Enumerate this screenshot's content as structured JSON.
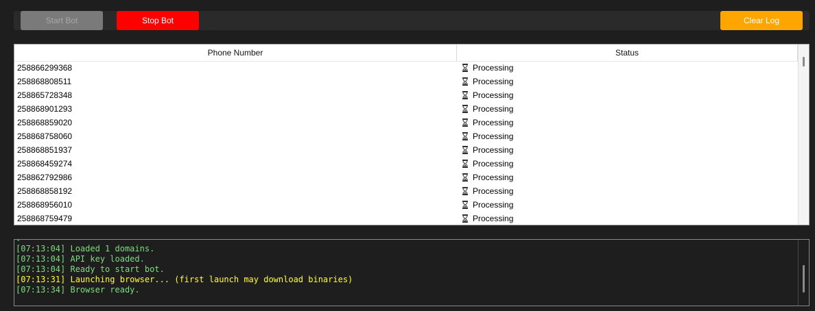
{
  "toolbar": {
    "start_label": "Start Bot",
    "stop_label": "Stop Bot",
    "clear_label": "Clear Log"
  },
  "table": {
    "columns": [
      "Phone Number",
      "Status"
    ],
    "rows": [
      {
        "phone": "258866299368",
        "status": "Processing",
        "status_icon": "hourglass-icon"
      },
      {
        "phone": "258868808511",
        "status": "Processing",
        "status_icon": "hourglass-icon"
      },
      {
        "phone": "258865728348",
        "status": "Processing",
        "status_icon": "hourglass-icon"
      },
      {
        "phone": "258868901293",
        "status": "Processing",
        "status_icon": "hourglass-icon"
      },
      {
        "phone": "258868859020",
        "status": "Processing",
        "status_icon": "hourglass-icon"
      },
      {
        "phone": "258868758060",
        "status": "Processing",
        "status_icon": "hourglass-icon"
      },
      {
        "phone": "258868851937",
        "status": "Processing",
        "status_icon": "hourglass-icon"
      },
      {
        "phone": "258868459274",
        "status": "Processing",
        "status_icon": "hourglass-icon"
      },
      {
        "phone": "258862792986",
        "status": "Processing",
        "status_icon": "hourglass-icon"
      },
      {
        "phone": "258868858192",
        "status": "Processing",
        "status_icon": "hourglass-icon"
      },
      {
        "phone": "258868956010",
        "status": "Processing",
        "status_icon": "hourglass-icon"
      },
      {
        "phone": "258868759479",
        "status": "Processing",
        "status_icon": "hourglass-icon"
      }
    ]
  },
  "log": {
    "lines": [
      {
        "text": "[07:13:04] Loaded 1 domains.",
        "color": "#7fdc7f"
      },
      {
        "text": "[07:13:04] API key loaded.",
        "color": "#7fdc7f"
      },
      {
        "text": "[07:13:04] Ready to start bot.",
        "color": "#7fdc7f"
      },
      {
        "text": "[07:13:31] Launching browser... (first launch may download binaries)",
        "color": "#ffff33"
      },
      {
        "text": "[07:13:34] Browser ready.",
        "color": "#7fdc7f"
      }
    ]
  },
  "colors": {
    "start_button": "#7a7a7a",
    "stop_button": "#ff0000",
    "clear_button": "#ffa500",
    "log_info": "#7fdc7f",
    "log_warning": "#ffff33",
    "background": "#1e1e1e"
  }
}
